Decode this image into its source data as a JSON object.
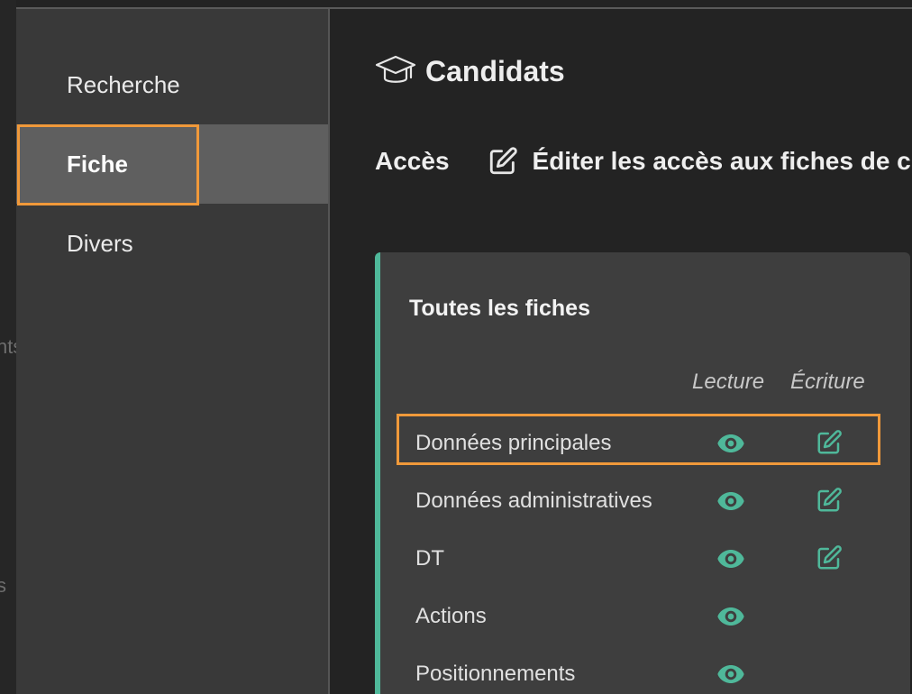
{
  "outer_rail": {
    "fragments": [
      "nts",
      "s"
    ]
  },
  "sidebar": {
    "items": [
      {
        "label": "Recherche",
        "active": false
      },
      {
        "label": "Fiche",
        "active": true
      },
      {
        "label": "Divers",
        "active": false
      }
    ]
  },
  "header": {
    "icon": "graduation-cap-icon",
    "title": "Candidats"
  },
  "access": {
    "label": "Accès",
    "edit_icon": "edit-icon",
    "edit_label": "Éditer les accès aux fiches de c"
  },
  "card": {
    "title": "Toutes les fiches",
    "columns": {
      "read": "Lecture",
      "write": "Écriture"
    },
    "rows": [
      {
        "label": "Données principales",
        "read": true,
        "write": true
      },
      {
        "label": "Données administratives",
        "read": true,
        "write": true
      },
      {
        "label": "DT",
        "read": true,
        "write": true
      },
      {
        "label": "Actions",
        "read": true,
        "write": false
      },
      {
        "label": "Positionnements",
        "read": true,
        "write": false
      }
    ]
  },
  "colors": {
    "accent": "#4fb89a",
    "highlight": "#f0993a",
    "sidebar_bg": "#393939",
    "sidebar_active_bg": "#5f5f5f",
    "main_bg": "#232323",
    "card_bg": "#3e3e3e"
  }
}
